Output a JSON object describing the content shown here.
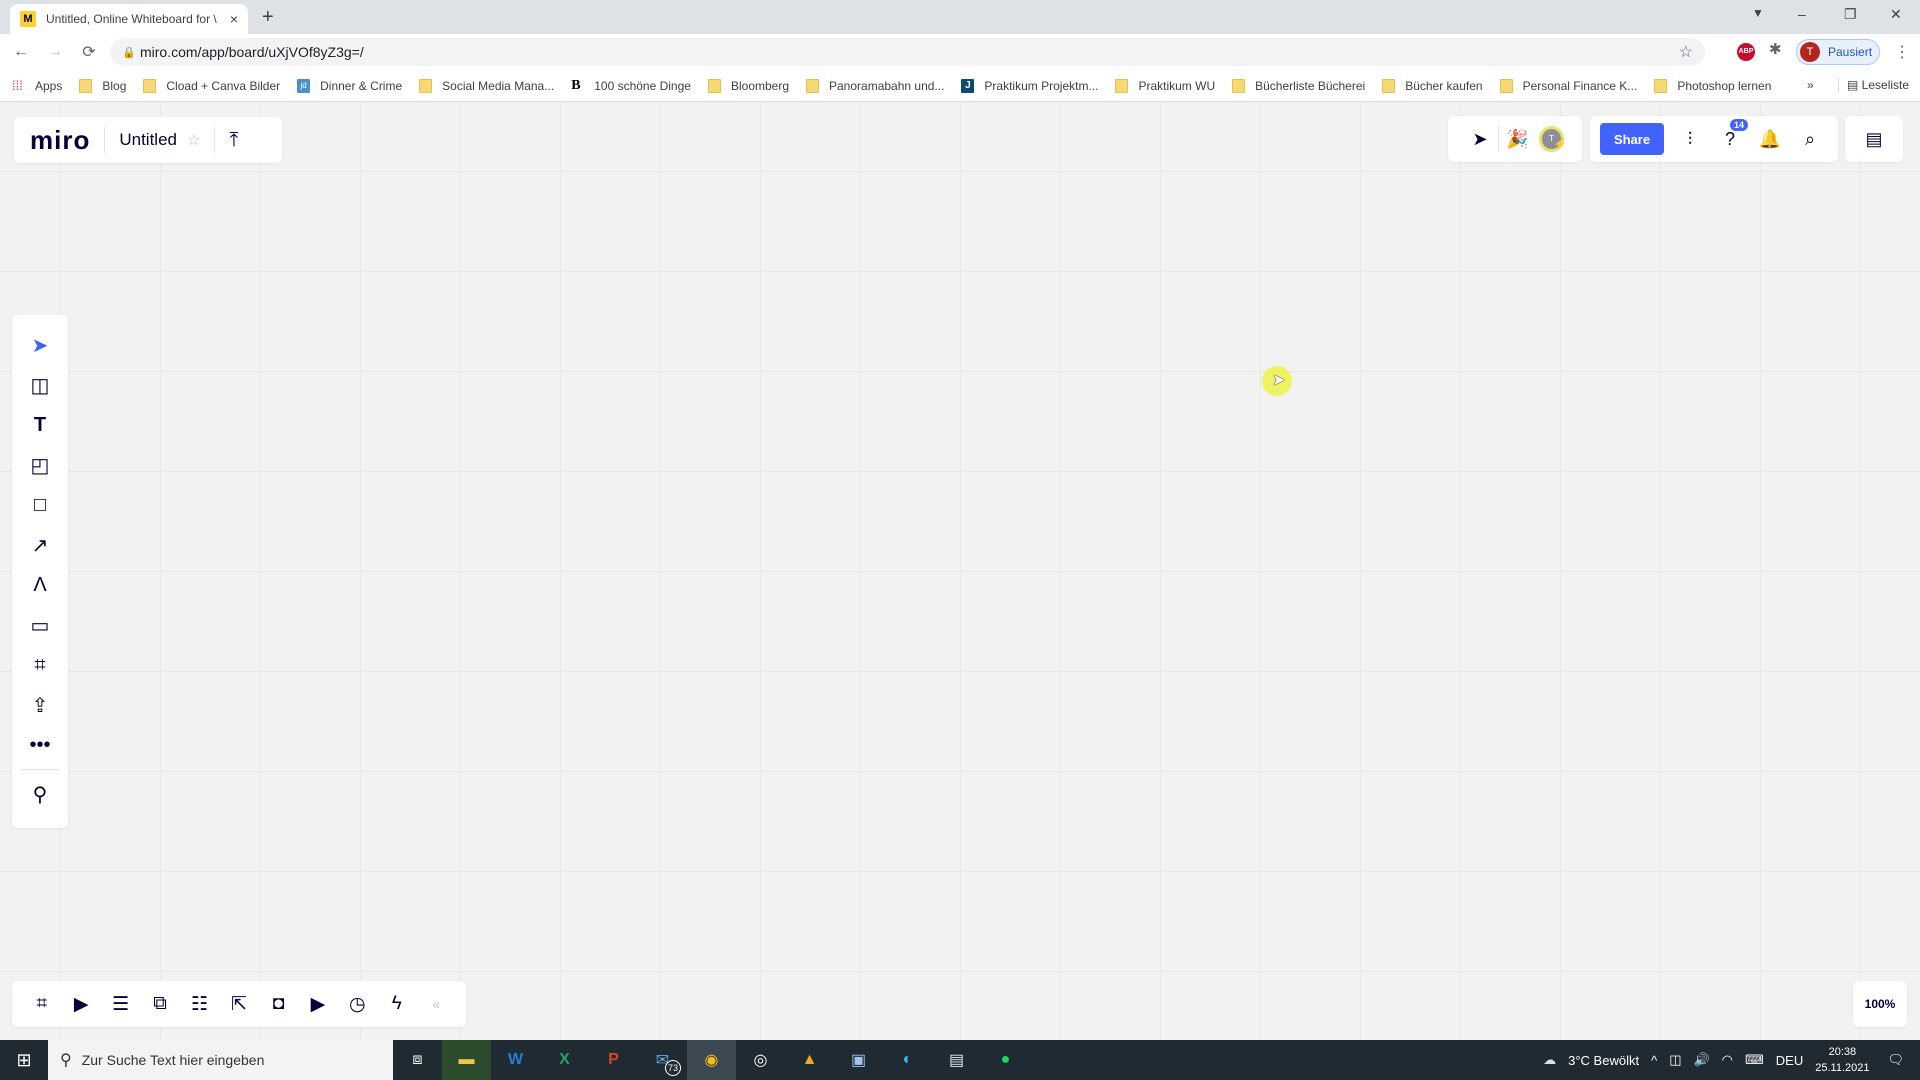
{
  "browser": {
    "tab": {
      "title": "Untitled, Online Whiteboard for \\",
      "favicon": "miro-favicon-icon",
      "close": "×"
    },
    "new_tab": "+",
    "window_controls": {
      "minimize": "–",
      "restore": "❐",
      "close": "✕"
    },
    "nav": {
      "back": "←",
      "forward": "→",
      "reload": "⟳"
    },
    "url": "miro.com/app/board/uXjVOf8yZ3g=/",
    "extensions": {
      "abp": "ABP"
    },
    "profile": {
      "initial": "T",
      "label": "Pausiert"
    },
    "bookmarks": [
      {
        "label": "Apps",
        "icon": "apps-icon"
      },
      {
        "label": "Blog",
        "icon": "folder-icon"
      },
      {
        "label": "Cload + Canva Bilder",
        "icon": "folder-icon"
      },
      {
        "label": "Dinner & Crime",
        "icon": "jd-icon"
      },
      {
        "label": "Social Media Mana...",
        "icon": "folder-icon"
      },
      {
        "label": "100 schöne Dinge",
        "icon": "b-icon"
      },
      {
        "label": "Bloomberg",
        "icon": "folder-icon"
      },
      {
        "label": "Panoramabahn und...",
        "icon": "folder-icon"
      },
      {
        "label": "Praktikum Projektm...",
        "icon": "j-icon"
      },
      {
        "label": "Praktikum WU",
        "icon": "folder-icon"
      },
      {
        "label": "Bücherliste Bücherei",
        "icon": "folder-icon"
      },
      {
        "label": "Bücher kaufen",
        "icon": "folder-icon"
      },
      {
        "label": "Personal Finance K...",
        "icon": "folder-icon"
      },
      {
        "label": "Photoshop lernen",
        "icon": "folder-icon"
      }
    ],
    "bookmarks_more": "»",
    "reading_list": "Leseliste"
  },
  "miro": {
    "logo": "miro",
    "board_title": "Untitled",
    "share_label": "Share",
    "help_badge": "14",
    "avatar_initial": "T",
    "zoom_level": "100%",
    "accent_color": "#4262ff",
    "left_tools": [
      "select-tool",
      "templates-tool",
      "text-tool",
      "sticky-note-tool",
      "shape-tool",
      "connection-line-tool",
      "pen-tool",
      "comment-tool",
      "frame-tool",
      "upload-tool",
      "more-tools",
      "apps-integrations"
    ],
    "bottom_tools": [
      "frames",
      "presentation",
      "comments",
      "screen-sharing",
      "card-list",
      "share-screen",
      "activity",
      "video-chat",
      "timer",
      "voting",
      "collapse"
    ]
  },
  "taskbar": {
    "search_placeholder": "Zur Suche Text hier eingeben",
    "mail_badge": "73",
    "weather": "3°C  Bewölkt",
    "language": "DEU",
    "time": "20:38",
    "date": "25.11.2021"
  }
}
